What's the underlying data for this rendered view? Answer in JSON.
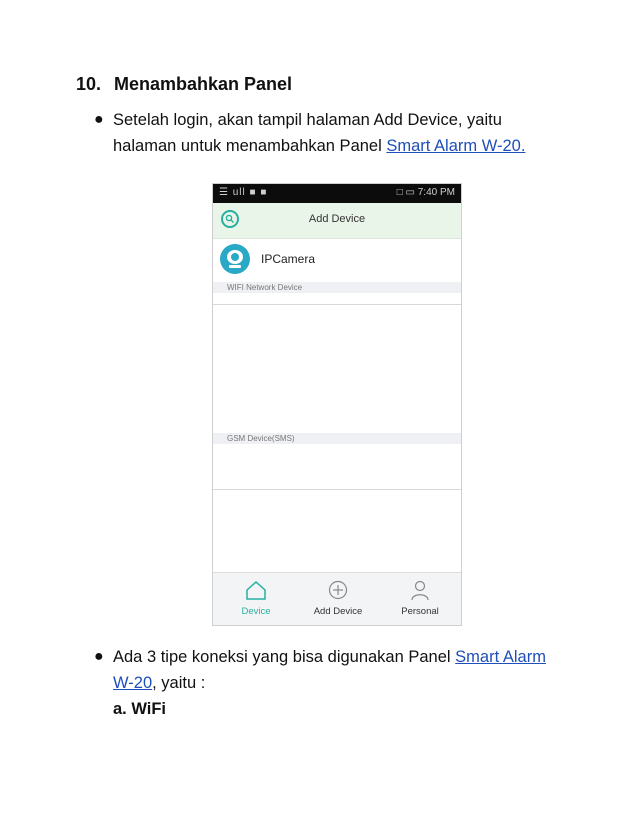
{
  "heading": {
    "number": "10.",
    "title": "Menambahkan Panel"
  },
  "bullet1": {
    "line1": "Setelah login, akan tampil halaman Add Device, yaitu",
    "line2_text": "halaman untuk menambahkan Panel ",
    "link": "Smart Alarm W-20."
  },
  "phone": {
    "status_left": "☰ ull ■ ■",
    "status_right": "□ ▭ 7:40 PM",
    "appbar_title": "Add Device",
    "device_name": "IPCamera",
    "section_wifi": "WIFI Network Device",
    "section_gsm": "GSM Device(SMS)",
    "tabs": [
      {
        "label": "Device",
        "icon": "home-icon",
        "color": "#27b0a0"
      },
      {
        "label": "Add Device",
        "icon": "plus-circle-icon",
        "color": "#333333"
      },
      {
        "label": "Personal",
        "icon": "person-icon",
        "color": "#333333"
      }
    ],
    "accent_color": "#27b0a0"
  },
  "bullet2": {
    "line1_text": "Ada 3 tipe koneksi yang bisa digunakan Panel ",
    "line1_link": "Smart Alarm",
    "line2_link": "W-20",
    "line2_text": ", yaitu :",
    "sub": "a. WiFi"
  }
}
